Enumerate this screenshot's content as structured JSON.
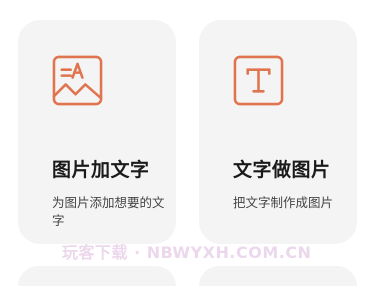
{
  "cards": [
    {
      "icon": "image-with-text-icon",
      "title": "图片加文字",
      "description": "为图片添加想要的文字"
    },
    {
      "icon": "text-t-icon",
      "title": "文字做图片",
      "description": "把文字制作成图片"
    }
  ],
  "watermark": "玩客下载 · NBWYXH.COM.CN",
  "colors": {
    "accent": "#e0744e",
    "card_background": "#f4f4f4",
    "title_text": "#1a1a1a",
    "description_text": "#444444",
    "watermark": "#ecd8ec"
  }
}
